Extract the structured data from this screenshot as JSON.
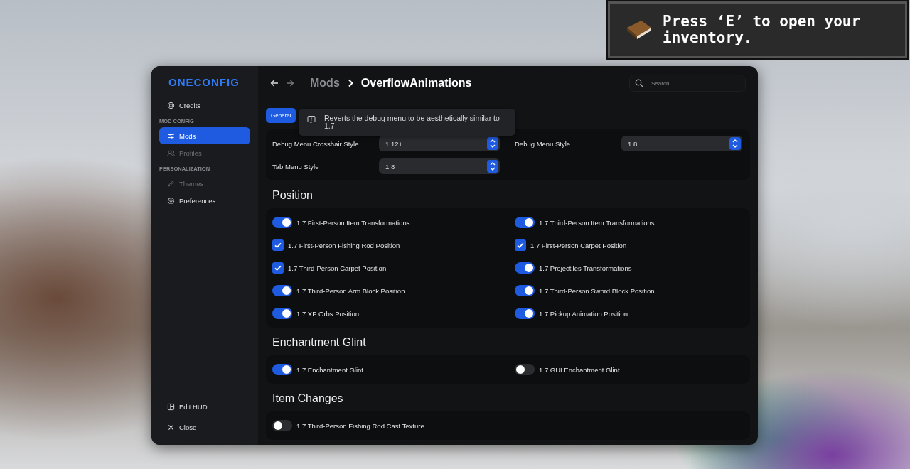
{
  "game_hint": {
    "text": "Press ‘E’ to open your inventory."
  },
  "sidebar": {
    "logo": "ONECONFIG",
    "top_items": [
      {
        "kind": "credits",
        "label": "Credits",
        "selected": false,
        "disabled": false
      }
    ],
    "groups": [
      {
        "heading": "MOD CONFIG",
        "items": [
          {
            "kind": "mods",
            "label": "Mods",
            "selected": true,
            "disabled": false
          },
          {
            "kind": "profiles",
            "label": "Profiles",
            "selected": false,
            "disabled": true
          }
        ]
      },
      {
        "heading": "PERSONALIZATION",
        "items": [
          {
            "kind": "themes",
            "label": "Themes",
            "selected": false,
            "disabled": true
          },
          {
            "kind": "preferences",
            "label": "Preferences",
            "selected": false,
            "disabled": false
          }
        ]
      }
    ],
    "bottom_items": [
      {
        "kind": "edit_hud",
        "label": "Edit HUD",
        "selected": false,
        "disabled": false
      },
      {
        "kind": "close",
        "label": "Close",
        "selected": false,
        "disabled": false
      }
    ]
  },
  "header": {
    "breadcrumb_parent": "Mods",
    "breadcrumb_current": "OverflowAnimations",
    "search": {
      "placeholder": "Search..."
    }
  },
  "tabs": [
    {
      "label": "General",
      "selected": true
    }
  ],
  "tooltip": {
    "text": "Reverts the debug menu to be aesthetically similar to 1.7"
  },
  "dropdowns": [
    {
      "label": "Debug Menu Crosshair Style",
      "value": "1.12+"
    },
    {
      "label": "Debug Menu Style",
      "value": "1.8"
    },
    {
      "label": "Tab Menu Style",
      "value": "1.8"
    }
  ],
  "sections": [
    {
      "title": "Position",
      "options": [
        {
          "kind": "toggle",
          "label": "1.7 First-Person Item Transformations",
          "on": true
        },
        {
          "kind": "toggle",
          "label": "1.7 Third-Person Item Transformations",
          "on": true
        },
        {
          "kind": "checkbox",
          "label": "1.7 First-Person Fishing Rod Position",
          "on": true
        },
        {
          "kind": "checkbox",
          "label": "1.7 First-Person Carpet Position",
          "on": true
        },
        {
          "kind": "checkbox",
          "label": "1.7 Third-Person Carpet Position",
          "on": true
        },
        {
          "kind": "toggle",
          "label": "1.7 Projectiles Transformations",
          "on": true
        },
        {
          "kind": "toggle",
          "label": "1.7 Third-Person Arm Block Position",
          "on": true
        },
        {
          "kind": "toggle",
          "label": "1.7 Third-Person Sword Block Position",
          "on": true
        },
        {
          "kind": "toggle",
          "label": "1.7 XP Orbs Position",
          "on": true
        },
        {
          "kind": "toggle",
          "label": "1.7 Pickup Animation Position",
          "on": true
        }
      ]
    },
    {
      "title": "Enchantment Glint",
      "options": [
        {
          "kind": "toggle",
          "label": "1.7 Enchantment Glint",
          "on": true
        },
        {
          "kind": "toggle",
          "label": "1.7 GUI Enchantment Glint",
          "on": false
        }
      ]
    },
    {
      "title": "Item Changes",
      "options": [
        {
          "kind": "toggle",
          "label": "1.7 Third-Person Fishing Rod Cast Texture",
          "on": false
        }
      ]
    }
  ]
}
